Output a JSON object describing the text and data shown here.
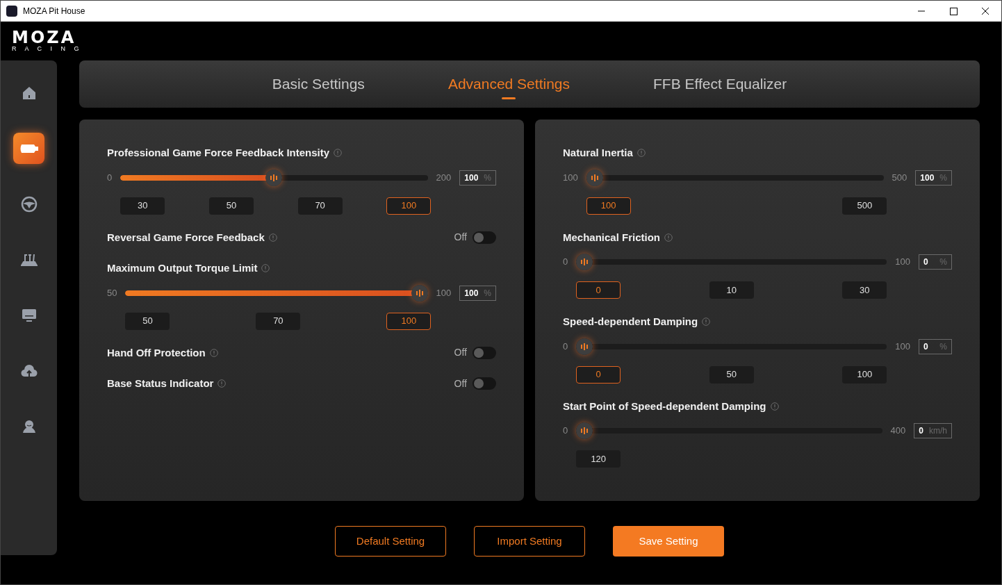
{
  "window": {
    "title": "MOZA Pit House"
  },
  "logo": {
    "name": "MOZA",
    "sub": "R A C I N G"
  },
  "sidebar": {
    "items": [
      {
        "kind": "home",
        "selected": false
      },
      {
        "kind": "base",
        "selected": true
      },
      {
        "kind": "wheel",
        "selected": false
      },
      {
        "kind": "pedals",
        "selected": false
      },
      {
        "kind": "display",
        "selected": false
      },
      {
        "kind": "cloud",
        "selected": false
      },
      {
        "kind": "user",
        "selected": false
      }
    ]
  },
  "tabs": [
    {
      "label": "Basic Settings",
      "selected": false
    },
    {
      "label": "Advanced Settings",
      "selected": true
    },
    {
      "label": "FFB Effect Equalizer",
      "selected": false
    }
  ],
  "panels": [
    {
      "settings": [
        {
          "kind": "slider",
          "title": "Professional Game Force Feedback Intensity",
          "min": "0",
          "max": "200",
          "level": 0.5,
          "value": "100",
          "unit": "%",
          "presets": [
            {
              "label": "30",
              "selected": false
            },
            {
              "label": "50",
              "selected": false
            },
            {
              "label": "70",
              "selected": false
            },
            {
              "label": "100",
              "selected": true
            }
          ]
        },
        {
          "kind": "toggle",
          "title": "Reversal Game Force Feedback",
          "state": "Off",
          "on": false
        },
        {
          "kind": "slider",
          "title": "Maximum Output Torque Limit",
          "min": "50",
          "max": "100",
          "level": 1,
          "value": "100",
          "unit": "%",
          "presets": [
            {
              "label": "50",
              "selected": false
            },
            {
              "label": "70",
              "selected": false
            },
            {
              "label": "100",
              "selected": true
            }
          ]
        },
        {
          "kind": "toggle",
          "title": "Hand Off Protection",
          "state": "Off",
          "on": false
        },
        {
          "kind": "toggle",
          "title": "Base Status Indicator",
          "state": "Off",
          "on": false
        }
      ]
    },
    {
      "settings": [
        {
          "kind": "slider",
          "title": "Natural Inertia",
          "min": "100",
          "max": "500",
          "level": 0,
          "value": "100",
          "unit": "%",
          "presets": [
            {
              "label": "100",
              "selected": true
            },
            {
              "label": "500",
              "selected": false
            }
          ]
        },
        {
          "kind": "slider",
          "title": "Mechanical Friction",
          "min": "0",
          "max": "100",
          "level": 0,
          "value": "0",
          "unit": "%",
          "presets": [
            {
              "label": "0",
              "selected": true
            },
            {
              "label": "10",
              "selected": false
            },
            {
              "label": "30",
              "selected": false
            }
          ]
        },
        {
          "kind": "slider",
          "title": "Speed-dependent Damping",
          "min": "0",
          "max": "100",
          "level": 0,
          "value": "0",
          "unit": "%",
          "presets": [
            {
              "label": "0",
              "selected": true
            },
            {
              "label": "50",
              "selected": false
            },
            {
              "label": "100",
              "selected": false
            }
          ]
        },
        {
          "kind": "slider",
          "title": "Start Point of Speed-dependent Damping",
          "min": "0",
          "max": "400",
          "level": 0,
          "value": "0",
          "unit": "km/h",
          "presets": [
            {
              "label": "120",
              "selected": false
            }
          ]
        }
      ]
    }
  ],
  "buttons": [
    {
      "label": "Default Setting",
      "kind": "outline"
    },
    {
      "label": "Import Setting",
      "kind": "outline"
    },
    {
      "label": "Save Setting",
      "kind": "primary"
    }
  ]
}
